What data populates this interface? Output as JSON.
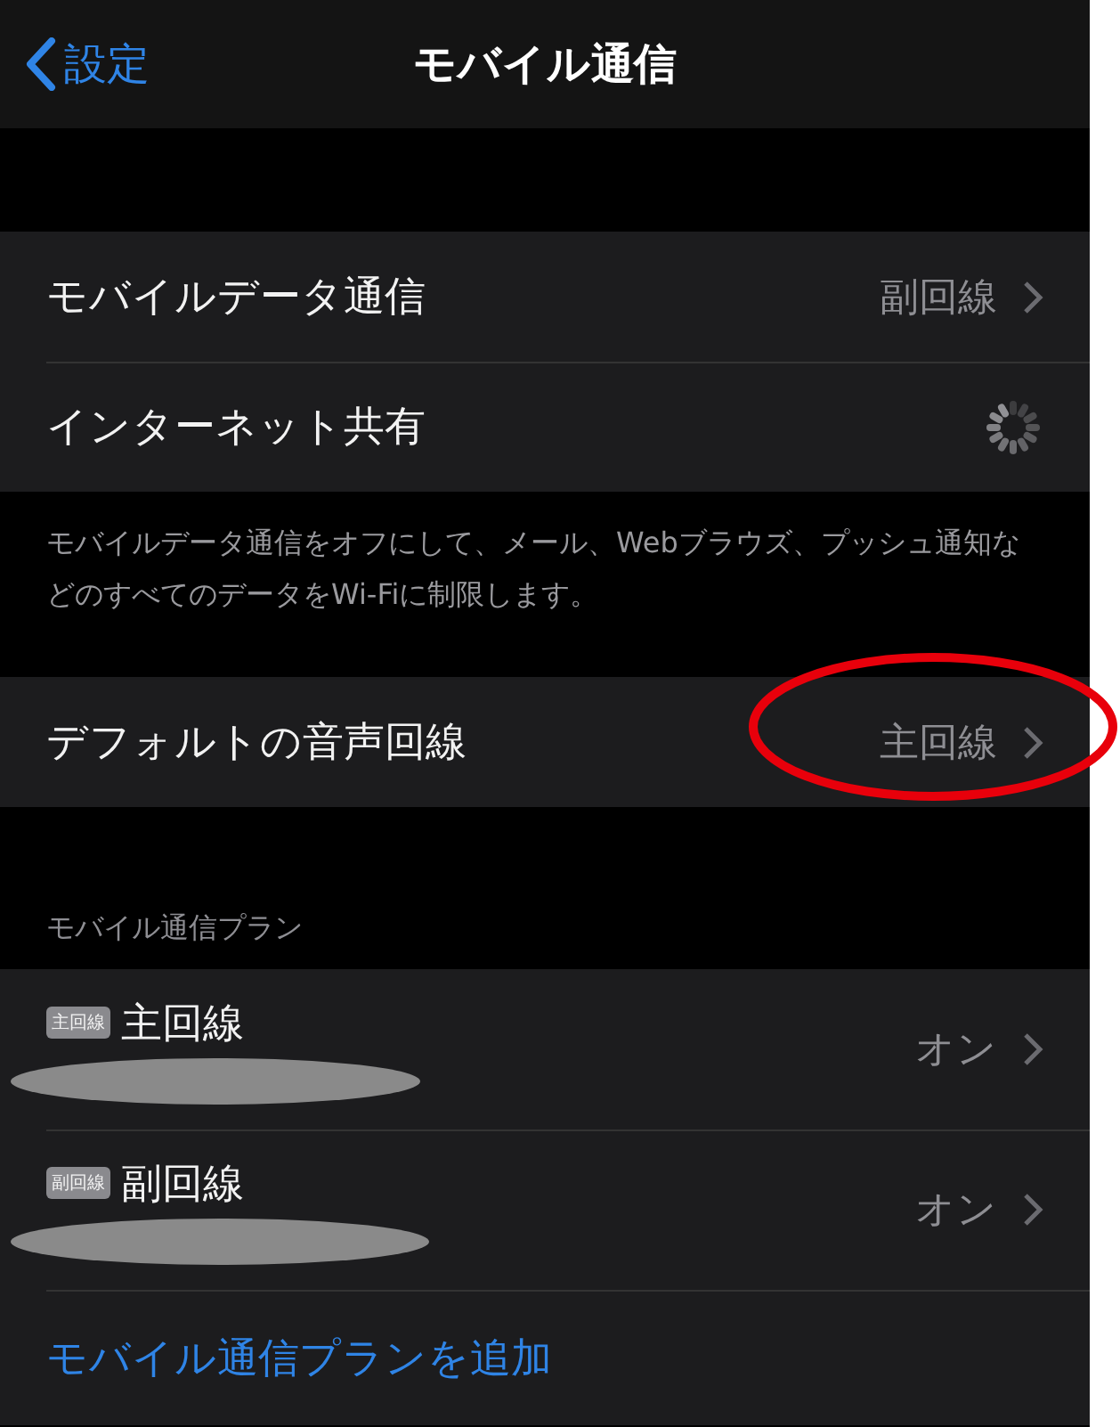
{
  "nav": {
    "back": "設定",
    "title": "モバイル通信"
  },
  "group_1": [
    {
      "kind": "value",
      "label": "モバイルデータ通信",
      "value": "副回線"
    },
    {
      "kind": "spinner",
      "label": "インターネット共有"
    }
  ],
  "group_1_footer": "モバイルデータ通信をオフにして、メール、Webブラウズ、プッシュ通知などのすべてのデータをWi-Fiに制限します。",
  "group_2": [
    {
      "kind": "value",
      "label": "デフォルトの音声回線",
      "value": "主回線",
      "circled": true
    }
  ],
  "plans_header": "モバイル通信プラン",
  "plans": [
    {
      "badge": "主回線",
      "label": "主回線",
      "value": "オン"
    },
    {
      "badge": "副回線",
      "label": "副回線",
      "value": "オン"
    }
  ],
  "add_plan": "モバイル通信プランを追加"
}
